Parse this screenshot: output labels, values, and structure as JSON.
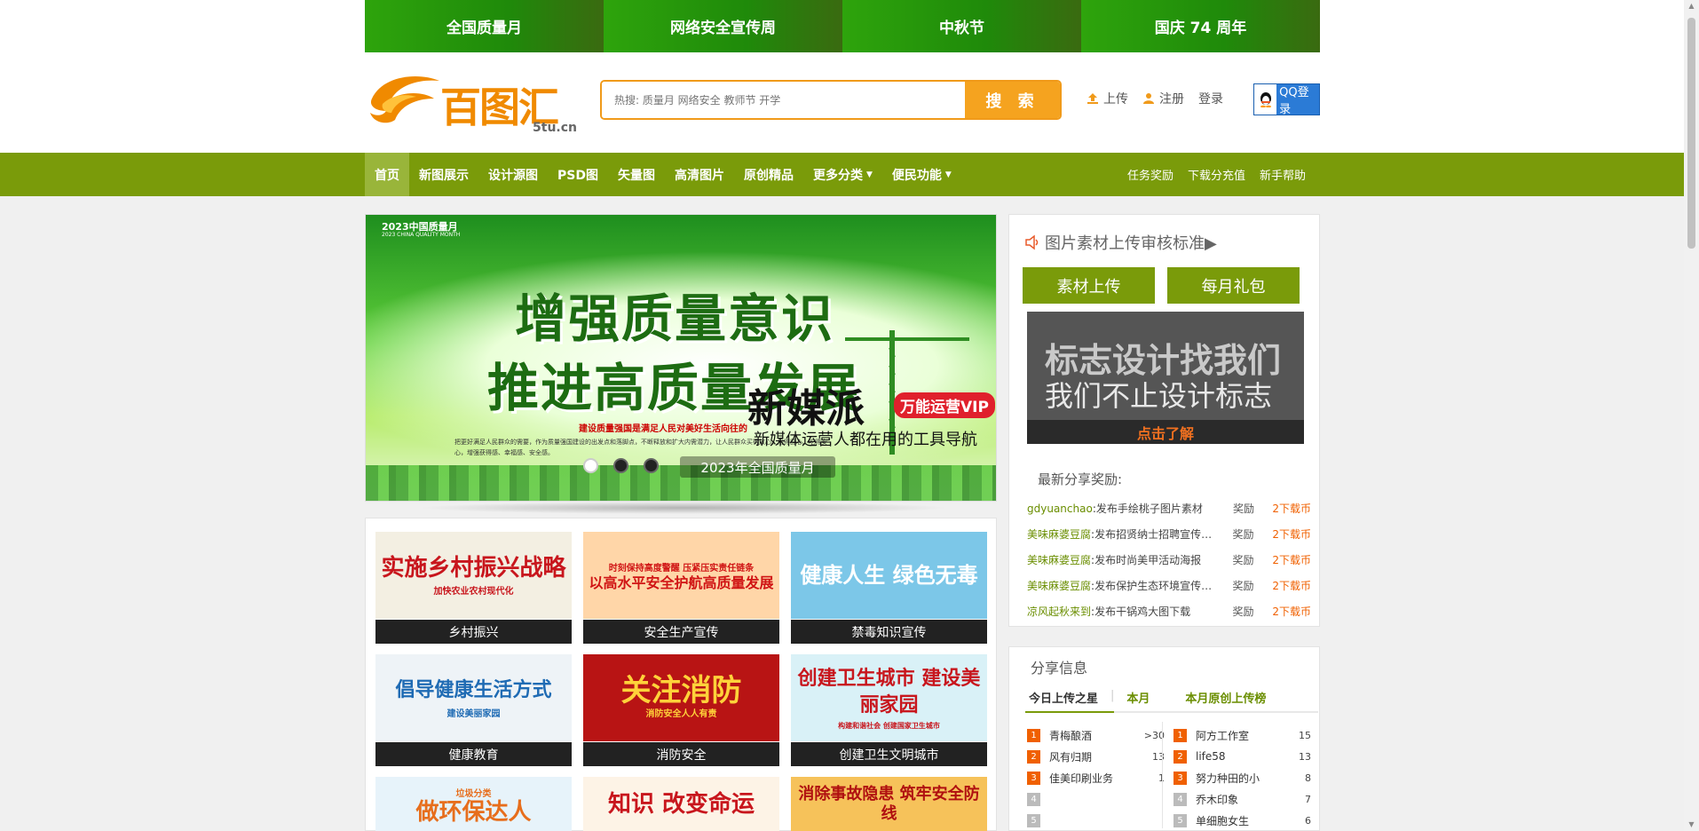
{
  "promo_tabs": [
    "全国质量月",
    "网络安全宣传周",
    "中秋节",
    "国庆 74 周年"
  ],
  "logo": {
    "text": "百图汇",
    "sub": "5tu.cn"
  },
  "search": {
    "placeholder": "热搜: 质量月 网络安全 教师节 开学",
    "button": "搜 索"
  },
  "user_links": {
    "upload": "上传",
    "register": "注册",
    "login": "登录",
    "qq_login": "QQ登录"
  },
  "nav": {
    "items": [
      "首页",
      "新图展示",
      "设计源图",
      "PSD图",
      "矢量图",
      "高清图片",
      "原创精品",
      "更多分类",
      "便民功能"
    ],
    "right": [
      "任务奖励",
      "下载分充值",
      "新手帮助"
    ]
  },
  "banner": {
    "year": "2023中国质量月",
    "year_sub": "2023 CHINA QUALITY MONTH",
    "line1": "增强质量意识",
    "line2": "推进高质量发展",
    "small": "建设质量强国是满足人民对美好生活向往的",
    "para": "把更好满足人民群众的需要，作为质量强国建设的出发点和落脚点，不断释放和扩大内需潜力，让人民群众买得放心、用得舒心、吃得安心，增强获得感、幸福感、安全感。",
    "caption": "2023年全国质量月",
    "ad_title": "新媒派",
    "ad_badge": "万能运营VIP",
    "ad_sub": "新媒体运营人都在用的工具导航"
  },
  "cards": [
    {
      "caption": "乡村振兴",
      "big": "实施乡村振兴战略",
      "small": "加快农业农村现代化",
      "bg": "#f3efe2",
      "fg": "#c8161d"
    },
    {
      "caption": "安全生产宣传",
      "big": "以高水平安全护航高质量发展",
      "small": "时刻保持高度警醒 压紧压实责任链条",
      "bg": "#ffd6a8",
      "fg": "#d01414"
    },
    {
      "caption": "禁毒知识宣传",
      "big": "健康人生 绿色无毒",
      "small": "",
      "bg": "#7cc7e8",
      "fg": "#ffffff"
    },
    {
      "caption": "健康教育",
      "big": "倡导健康生活方式",
      "small": "建设美丽家园",
      "bg": "#eef3f7",
      "fg": "#1f6bb4"
    },
    {
      "caption": "消防安全",
      "big": "关注消防",
      "small": "消防安全人人有责",
      "bg": "#b81414",
      "fg": "#ffd23a"
    },
    {
      "caption": "创建卫生文明城市",
      "big": "创建卫生城市 建设美丽家园",
      "small": "构建和谐社会 创建国家卫生城市",
      "bg": "#d9f1f7",
      "fg": "#c8161d"
    },
    {
      "caption": "",
      "big": "做环保达人",
      "small": "垃圾分类",
      "bg": "#e7f3fa",
      "fg": "#e76e1c"
    },
    {
      "caption": "",
      "big": "知识 改变命运",
      "small": "",
      "bg": "#fdf3e6",
      "fg": "#c8161d"
    },
    {
      "caption": "",
      "big": "消除事故隐患 筑牢安全防线",
      "small": "",
      "bg": "#f6c25a",
      "fg": "#b01010"
    }
  ],
  "side1": {
    "title": "图片素材上传审核标准▶",
    "btn_upload": "素材上传",
    "btn_gift": "每月礼包",
    "ad_line1": "标志设计找我们",
    "ad_line2": "我们不止设计标志",
    "ad_cta": "点击了解",
    "rewards_title": "最新分享奖励:",
    "rewards": [
      {
        "user": "gdyuanchao",
        "action": "发布手绘桃子图片素材",
        "label": "奖励",
        "coin": "2下载币"
      },
      {
        "user": "美味麻婆豆腐",
        "action": "发布招贤纳士招聘宣传…",
        "label": "奖励",
        "coin": "2下载币"
      },
      {
        "user": "美味麻婆豆腐",
        "action": "发布时尚美甲活动海报",
        "label": "奖励",
        "coin": "2下载币"
      },
      {
        "user": "美味麻婆豆腐",
        "action": "发布保护生态环境宣传…",
        "label": "奖励",
        "coin": "2下载币"
      },
      {
        "user": "凉风起秋来到",
        "action": "发布干锅鸡大图下载",
        "label": "奖励",
        "coin": "2下载币"
      }
    ]
  },
  "side2": {
    "title": "分享信息",
    "tabs": [
      "今日上传之星",
      "本月",
      "本月原创上传榜"
    ],
    "left_rank": [
      {
        "n": "1",
        "name": "青梅酿酒",
        "count": ">30"
      },
      {
        "n": "2",
        "name": "风有归期",
        "count": "13"
      },
      {
        "n": "3",
        "name": "佳美印刷业务",
        "count": "1"
      },
      {
        "n": "4",
        "name": "",
        "count": ""
      },
      {
        "n": "5",
        "name": "",
        "count": ""
      }
    ],
    "right_rank": [
      {
        "n": "1",
        "name": "阿方工作室",
        "count": "15"
      },
      {
        "n": "2",
        "name": "life58",
        "count": "13"
      },
      {
        "n": "3",
        "name": "努力种田的小",
        "count": "8"
      },
      {
        "n": "4",
        "name": "乔木印象",
        "count": "7"
      },
      {
        "n": "5",
        "name": "单细胞女生",
        "count": "6"
      }
    ]
  },
  "colors": {
    "nav": "#7a9b0a",
    "accent": "#f5a31f",
    "promo": "#2ea40c",
    "coin": "#f06000"
  }
}
